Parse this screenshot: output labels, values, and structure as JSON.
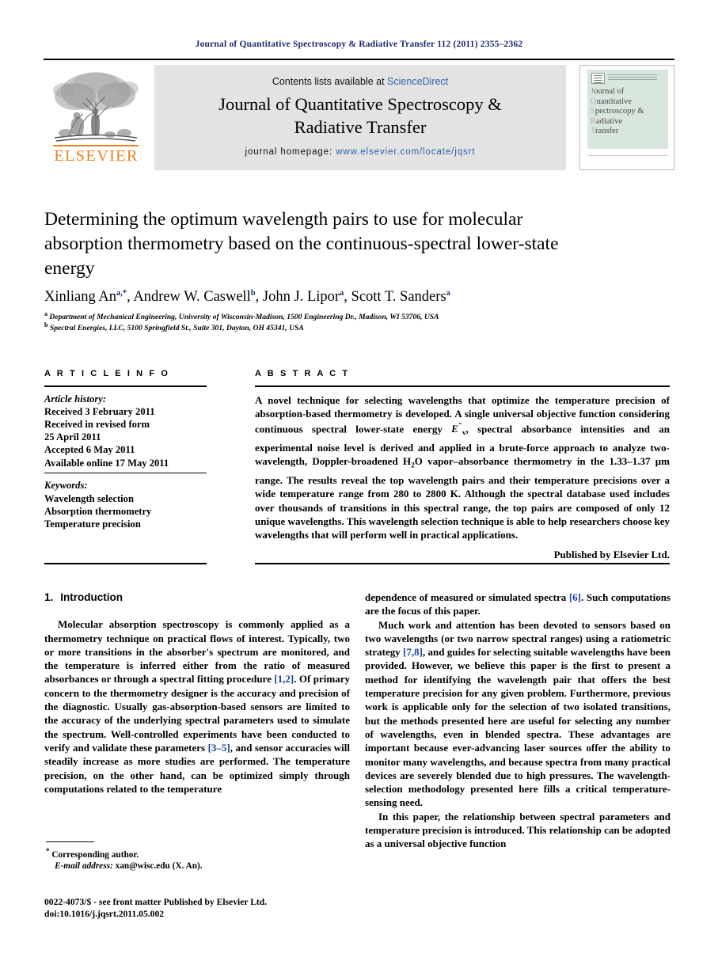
{
  "running_head": "Journal of Quantitative Spectroscopy & Radiative Transfer 112 (2011) 2355–2362",
  "masthead": {
    "contents_prefix": "Contents lists available at ",
    "sciencedirect": "ScienceDirect",
    "journal_title_line1": "Journal of Quantitative Spectroscopy &",
    "journal_title_line2": "Radiative Transfer",
    "homepage_prefix": "journal homepage: ",
    "homepage_url": "www.elsevier.com/locate/jqsrt",
    "publisher_logo_word": "ELSEVIER",
    "link_color": "#2f5fa8",
    "band_color": "#e3e3e3",
    "elsevier_orange": "#f08020"
  },
  "cover_thumbnail": {
    "line1_cap": "J",
    "line1_rest": "ournal of",
    "line2_cap": "Q",
    "line2_rest": "uantitative",
    "line3_cap": "S",
    "line3_rest": "pectroscopy &",
    "line4_cap": "R",
    "line4_rest": "adiative",
    "line5_cap": "T",
    "line5_rest": "ransfer",
    "background": "#d9e6dd"
  },
  "title": "Determining the optimum wavelength pairs to use for molecular absorption thermometry based on the continuous-spectral lower-state energy",
  "authors": [
    {
      "name": "Xinliang An",
      "marks": "a,*"
    },
    {
      "name": "Andrew W. Caswell",
      "marks": "b"
    },
    {
      "name": "John J. Lipor",
      "marks": "a"
    },
    {
      "name": "Scott T. Sanders",
      "marks": "a"
    }
  ],
  "affiliations": [
    {
      "mark": "a",
      "text": "Department of Mechanical Engineering, University of Wisconsin-Madison, 1500 Engineering Dr., Madison, WI 53706, USA"
    },
    {
      "mark": "b",
      "text": "Spectral Energies, LLC, 5100 Springfield St., Suite 301, Dayton, OH 45341, USA"
    }
  ],
  "article_info": {
    "heading": "A R T I C L E   I N F O",
    "history_label": "Article history:",
    "history": [
      "Received 3 February 2011",
      "Received in revised form",
      "25 April 2011",
      "Accepted 6 May 2011",
      "Available online 17 May 2011"
    ],
    "keywords_label": "Keywords:",
    "keywords": [
      "Wavelength selection",
      "Absorption thermometry",
      "Temperature precision"
    ]
  },
  "abstract": {
    "heading": "A B S T R A C T",
    "part1": "A novel technique for selecting wavelengths that optimize the temperature precision of absorption-based thermometry is developed. A single universal objective function considering continuous spectral lower-state energy ",
    "energy_symbol": "E",
    "energy_sup": "″",
    "energy_sub": "v",
    "part2": ", spectral absorbance intensities and an experimental noise level is derived and applied in a brute-force approach to analyze two-wavelength, Doppler-broadened H",
    "h2o_sub": "2",
    "part3": "O vapor–absorbance thermometry in the 1.33–1.37 μm range. The results reveal the top wavelength pairs and their temperature precisions over a wide temperature range from 280 to 2800 K. Although the spectral database used includes over thousands of transitions in this spectral range, the top pairs are composed of only 12 unique wavelengths. This wavelength selection technique is able to help researchers choose key wavelengths that will perform well in practical applications.",
    "published_by": "Published by Elsevier Ltd."
  },
  "body": {
    "section1_number": "1.",
    "section1_title": "Introduction",
    "left": {
      "p1_a": "Molecular absorption spectroscopy is commonly applied as a thermometry technique on practical flows of interest. Typically, two or more transitions in the absorber's spectrum are monitored, and the temperature is inferred either from the ratio of measured absorbances or through a spectral fitting procedure ",
      "p1_ref1": "[1,2]",
      "p1_b": ". Of primary concern to the thermometry designer is the accuracy and precision of the diagnostic. Usually gas-absorption-based sensors are limited to the accuracy of the underlying spectral parameters used to simulate the spectrum. Well-controlled experiments have been conducted to verify and validate these parameters ",
      "p1_ref2": "[3–5]",
      "p1_c": ", and sensor accuracies will steadily increase as more studies are performed. The temperature precision, on the other hand, can be optimized simply through computations related to the temperature"
    },
    "right": {
      "p1_a": "dependence of measured or simulated spectra ",
      "p1_ref1": "[6]",
      "p1_b": ". Such computations are the focus of this paper.",
      "p2_a": "Much work and attention has been devoted to sensors based on two wavelengths (or two narrow spectral ranges) using a ratiometric strategy ",
      "p2_ref1": "[7,8]",
      "p2_b": ", and guides for selecting suitable wavelengths have been provided. However, we believe this paper is the first to present a method for identifying the wavelength pair that offers the best temperature precision for any given problem. Furthermore, previous work is applicable only for the selection of two isolated transitions, but the methods presented here are useful for selecting any number of wavelengths, even in blended spectra. These advantages are important because ever-advancing laser sources offer the ability to monitor many wavelengths, and because spectra from many practical devices are severely blended due to high pressures. The wavelength-selection methodology presented here fills a critical temperature-sensing need.",
      "p3": "In this paper, the relationship between spectral parameters and temperature precision is introduced. This relationship can be adopted as a universal objective function"
    }
  },
  "footnote": {
    "marker": "*",
    "corresponding": "Corresponding author.",
    "email_label": "E-mail address:",
    "email": " xan@wisc.edu (X. An)."
  },
  "page_footer": {
    "line1": "0022-4073/$ - see front matter Published by Elsevier Ltd.",
    "line2": "doi:10.1016/j.jqsrt.2011.05.002"
  }
}
